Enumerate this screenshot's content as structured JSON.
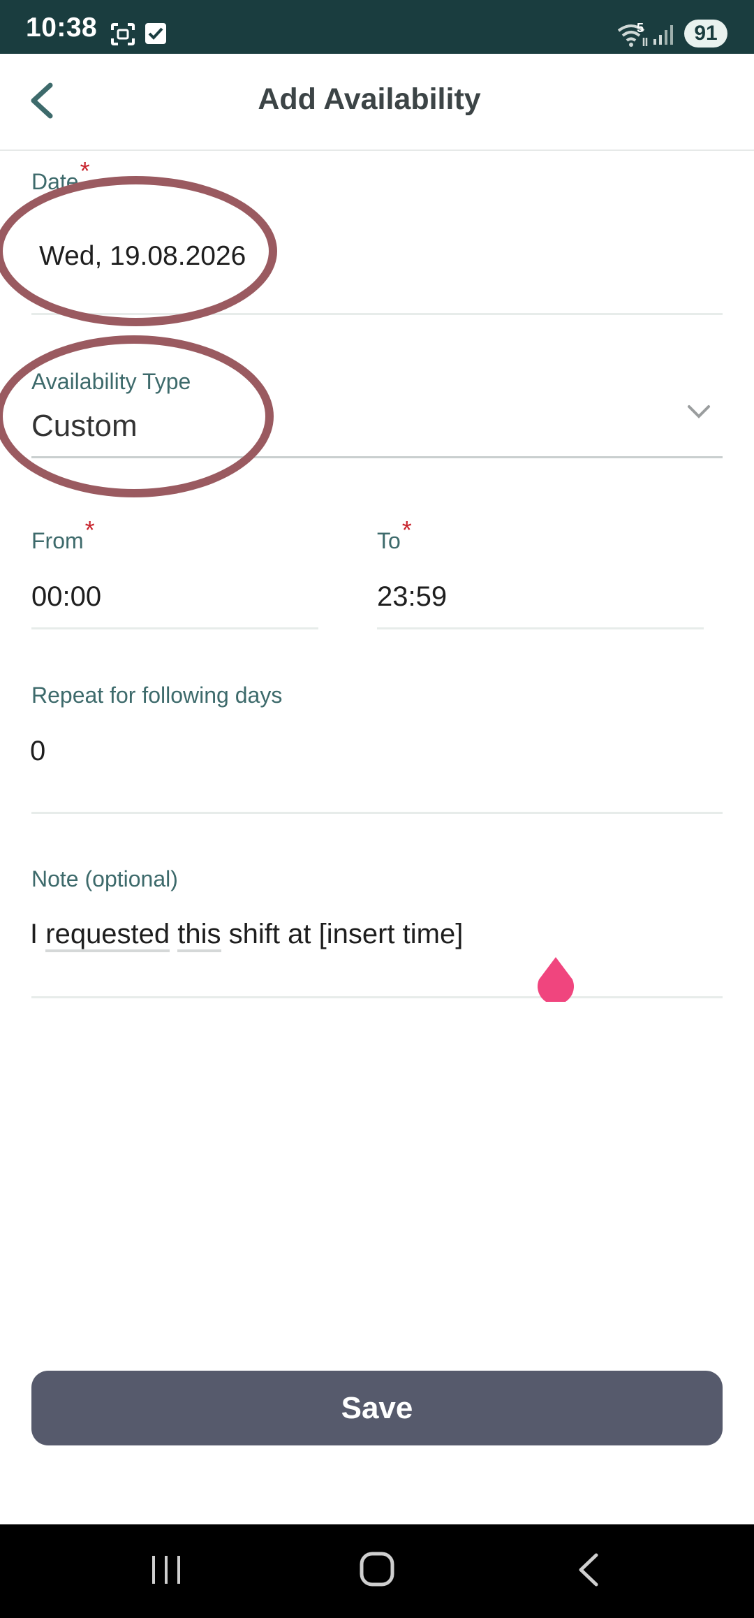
{
  "status_bar": {
    "time": "10:38",
    "wifi_badge": "5",
    "battery": "91",
    "icons": [
      "screenshot-icon",
      "checkbox-icon",
      "wifi-icon",
      "signal-icon"
    ]
  },
  "header": {
    "title": "Add Availability",
    "back_icon": "chevron-left-icon"
  },
  "form": {
    "date": {
      "label": "Date",
      "required": "*",
      "value": "Wed, 19.08.2026"
    },
    "availability_type": {
      "label": "Availability Type",
      "value": "Custom"
    },
    "from": {
      "label": "From",
      "required": "*",
      "value": "00:00"
    },
    "to": {
      "label": "To",
      "required": "*",
      "value": "23:59"
    },
    "repeat": {
      "label": "Repeat for following days",
      "value": "0"
    },
    "note": {
      "label": "Note (optional)",
      "value_parts": [
        "I",
        "requested",
        "this",
        "shift at [insert time]"
      ]
    }
  },
  "save_button": {
    "label": "Save"
  },
  "colors": {
    "status_bar": "#1a3d3f",
    "accent_label": "#3d6a6b",
    "required": "#c8232c",
    "annotation": "#9a5a60",
    "save_button": "#565a6c",
    "cursor_handle": "#f0457e"
  },
  "nav_bar": {
    "icons": [
      "recents-icon",
      "home-icon",
      "back-icon"
    ]
  }
}
